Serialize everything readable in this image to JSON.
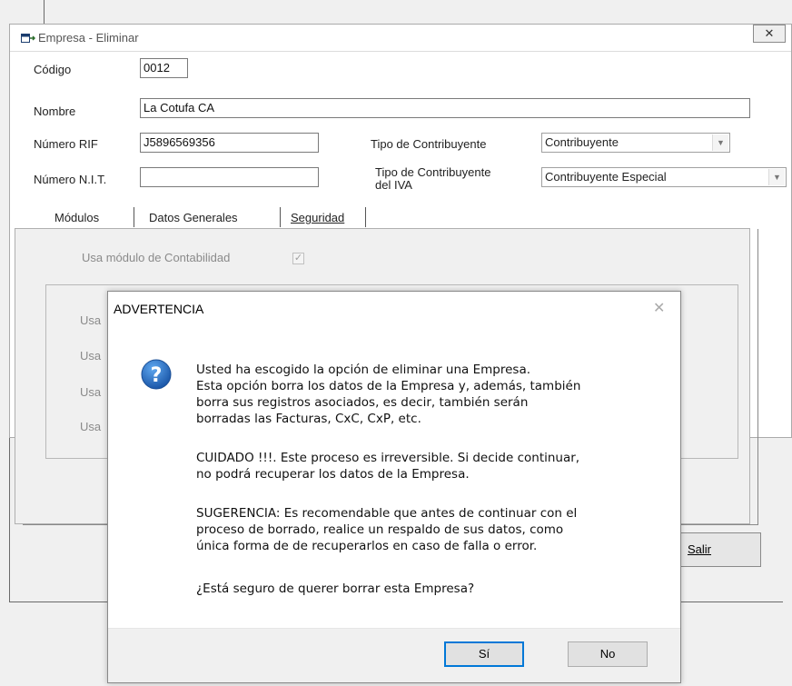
{
  "window": {
    "title": "Empresa - Eliminar",
    "close_glyph": "✕"
  },
  "form": {
    "codigo_label": "Código",
    "codigo_value": "0012",
    "nombre_label": "Nombre",
    "nombre_value": "La Cotufa CA",
    "rif_label": "Número RIF",
    "rif_value": "J5896569356",
    "nit_label": "Número N.I.T.",
    "nit_value": "",
    "tipo_contribuyente_label": "Tipo de Contribuyente",
    "tipo_contribuyente_value": "Contribuyente",
    "tipo_iva_label_line1": "Tipo de Contribuyente",
    "tipo_iva_label_line2": "del IVA",
    "tipo_iva_value": "Contribuyente Especial"
  },
  "tabs": [
    {
      "label": "Módulos",
      "active": true
    },
    {
      "label": "Datos Generales",
      "active": false
    },
    {
      "label": "Seguridad",
      "active": false
    }
  ],
  "modules": {
    "contabilidad_label": "Usa módulo de Contabilidad",
    "contabilidad_checked": true,
    "rows": [
      "Usa",
      "Usa",
      "Usa",
      "Usa"
    ]
  },
  "buttons": {
    "salir_label": "Salir"
  },
  "dialog": {
    "title": "ADVERTENCIA",
    "close_glyph": "✕",
    "icon": "question-icon",
    "paragraph1": "Usted ha escogido la opción de eliminar una Empresa.\nEsta opción borra los datos de la Empresa y, además, también\nborra sus registros asociados, es decir, también serán\nborradas las Facturas, CxC, CxP, etc.",
    "paragraph2": "CUIDADO !!!. Este proceso es irreversible. Si decide continuar,\nno podrá recuperar los datos de la Empresa.",
    "paragraph3": "SUGERENCIA: Es recomendable que antes de continuar con el\nproceso de borrado, realice un respaldo de sus datos, como\núnica forma de de recuperarlos en caso de falla o error.",
    "question": "¿Está seguro de querer borrar esta Empresa?",
    "yes_label": "Sí",
    "no_label": "No"
  },
  "colors": {
    "dialog_bg": "#ffffff",
    "footer_bg": "#f0f0f0",
    "accent": "#0078d7"
  }
}
